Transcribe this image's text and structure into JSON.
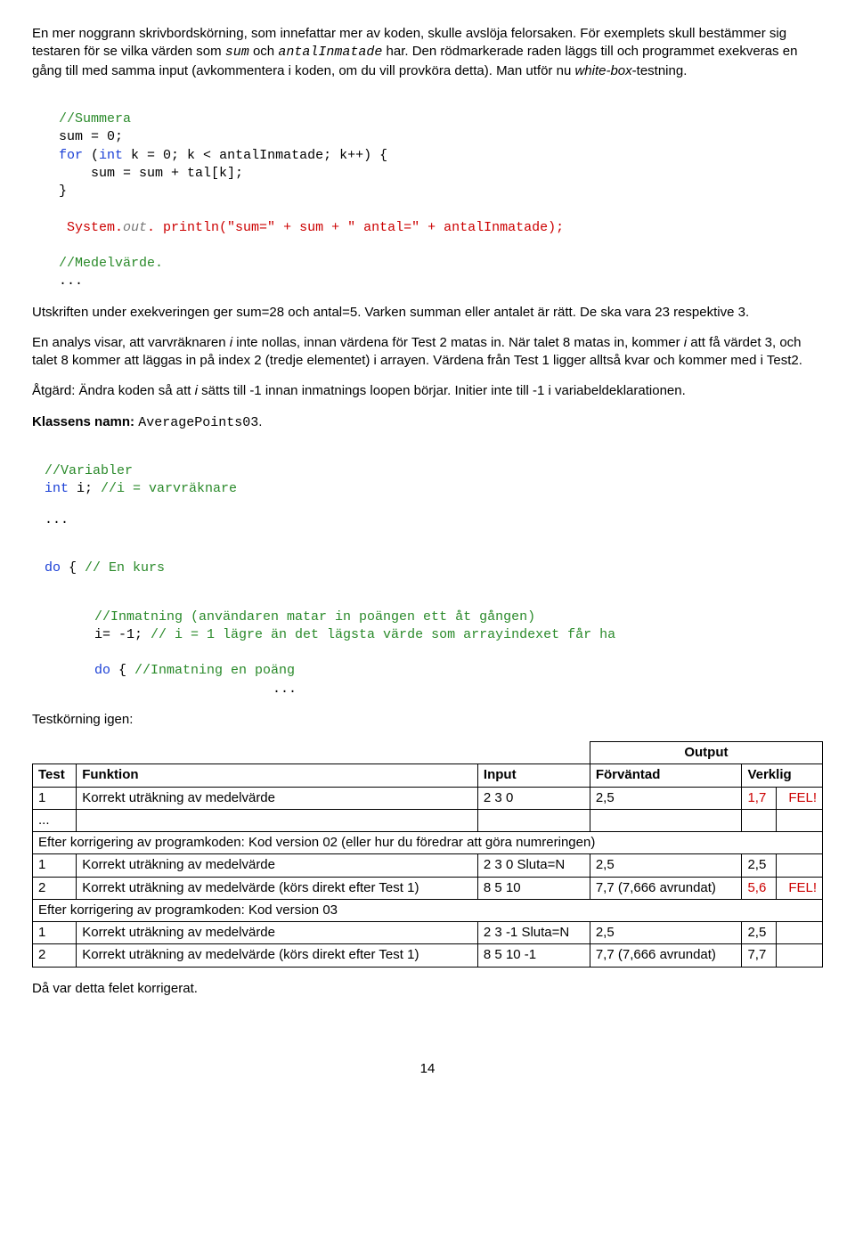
{
  "intro": {
    "p1a": "En mer noggrann skrivbordskörning, som innefattar mer av koden, skulle avslöja felorsaken. För exemplets skull bestämmer sig testaren för se vilka värden som ",
    "var1": "sum",
    "p1b": " och ",
    "var2": "antalInmatade",
    "p1c": " har. Den rödmarkerade raden läggs till och programmet exekveras en gång till med samma input (avkommentera i koden, om du vill provköra detta). Man utför nu ",
    "italic1": "white-box",
    "p1d": "-testning."
  },
  "code1": {
    "c1": "//Summera",
    "l1a": "sum = 0;",
    "l2a": "for",
    "l2b": " (",
    "l2c": "int",
    "l2d": " k = 0; k < antalInmatade; k++) {",
    "l3": "    sum = sum + tal[k];",
    "l4": "}",
    "l5a": " System.",
    "l5b": "out",
    "l5c": ". println(",
    "l5d": "\"sum=\"",
    "l5e": " + sum + ",
    "l5f": "\" antal=\"",
    "l5g": " + antalInmatade);",
    "c2": "//Medelvärde.",
    "dots": "..."
  },
  "mid": {
    "p2": "Utskriften under exekveringen ger sum=28 och antal=5. Varken summan eller antalet är rätt. De ska vara 23 respektive 3.",
    "p3a": "En analys visar, att varvräknaren ",
    "p3i1": "i",
    "p3b": " inte nollas, innan värdena för Test 2 matas in. När talet 8 matas in, kommer ",
    "p3i2": "i",
    "p3c": " att få värdet 3, och talet 8 kommer att läggas in på index 2 (tredje elementet) i arrayen. Värdena från Test 1 ligger alltså kvar och kommer med i Test2.",
    "p4a": "Åtgärd: Ändra koden så att ",
    "p4i": "i",
    "p4b": " sätts till -1 innan inmatnings loopen börjar. Initier inte till -1 i variabeldeklarationen.",
    "p5a": "Klassens namn: ",
    "p5mono": "AveragePoints03",
    "p5b": "."
  },
  "code2": {
    "c1": "//Variabler",
    "l1a": "int",
    "l1b": " i; ",
    "l1c": "//i = varvräknare",
    "dots": "...",
    "l2a": "do",
    "l2b": " { ",
    "l2c": "// En kurs",
    "c2": "//Inmatning (användaren matar in poängen ett åt gången)",
    "l3a": "i= -1; ",
    "l3b": "// i = 1 lägre än det lägsta värde som arrayindexet får ha",
    "l4a": "do",
    "l4b": " { ",
    "l4c": "//Inmatning en poäng",
    "trail": "..."
  },
  "after": {
    "p6": "Testkörning igen:"
  },
  "table": {
    "h_output": "Output",
    "h_test": "Test",
    "h_funktion": "Funktion",
    "h_input": "Input",
    "h_forvantad": "Förväntad",
    "h_verklig": "Verklig",
    "r1": {
      "test": "1",
      "funk": "Korrekt uträkning av medelvärde",
      "input": "2 3 0",
      "forv": "2,5",
      "verk": "1,7",
      "fel": "FEL!"
    },
    "r2": {
      "test": "...",
      "funk": "",
      "input": "",
      "forv": "",
      "verk": "",
      "fel": ""
    },
    "band1": "Efter korrigering av programkoden: Kod version 02 (eller hur du föredrar att göra numreringen)",
    "r3": {
      "test": "1",
      "funk": "Korrekt uträkning av medelvärde",
      "input": "2 3 0  Sluta=N",
      "forv": "2,5",
      "verk": "2,5",
      "fel": ""
    },
    "r4": {
      "test": "2",
      "funk": "Korrekt uträkning av medelvärde (körs direkt efter Test 1)",
      "input": "8 5 10",
      "forv": "7,7 (7,666 avrundat)",
      "verk": "5,6",
      "fel": "FEL!"
    },
    "band2": "Efter korrigering av programkoden: Kod version 03",
    "r5": {
      "test": "1",
      "funk": "Korrekt uträkning av medelvärde",
      "input": "2 3 -1  Sluta=N",
      "forv": "2,5",
      "verk": "2,5",
      "fel": ""
    },
    "r6": {
      "test": "2",
      "funk": "Korrekt uträkning av medelvärde (körs direkt efter Test 1)",
      "input": "8 5 10 -1",
      "forv": "7,7 (7,666 avrundat)",
      "verk": "7,7",
      "fel": ""
    }
  },
  "closing": {
    "p7": "Då var detta felet korrigerat."
  },
  "page": "14"
}
